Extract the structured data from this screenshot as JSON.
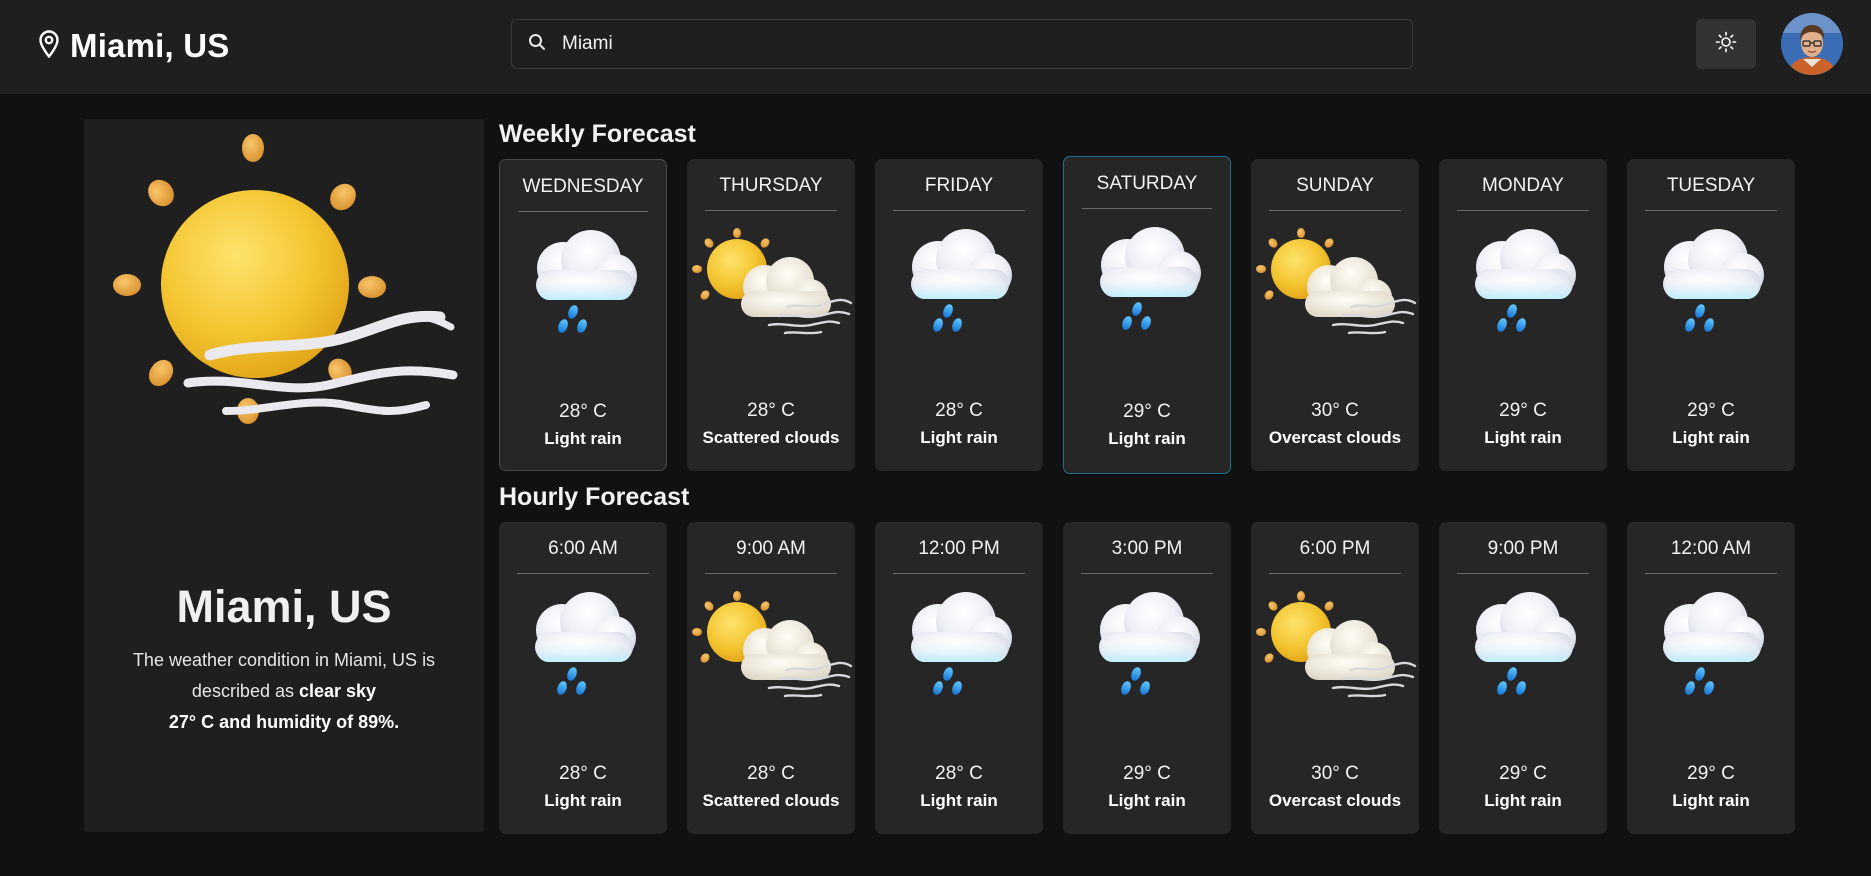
{
  "header": {
    "location": "Miami, US",
    "search_value": "Miami"
  },
  "current": {
    "city": "Miami, US",
    "desc_prefix": "The weather condition in Miami, US is described as",
    "desc_condition": "clear sky",
    "desc_detail": "27° C and humidity of 89%.",
    "icon": "sun-with-wind-icon"
  },
  "weekly": {
    "title": "Weekly Forecast",
    "days": [
      {
        "label": "Wednesday",
        "temp": "28° C",
        "cond": "Light rain",
        "icon": "rain-cloud-icon"
      },
      {
        "label": "Thursday",
        "temp": "28° C",
        "cond": "Scattered clouds",
        "icon": "partly-cloudy-wind-icon"
      },
      {
        "label": "Friday",
        "temp": "28° C",
        "cond": "Light rain",
        "icon": "rain-cloud-icon"
      },
      {
        "label": "Saturday",
        "temp": "29° C",
        "cond": "Light rain",
        "icon": "rain-cloud-icon"
      },
      {
        "label": "Sunday",
        "temp": "30° C",
        "cond": "Overcast clouds",
        "icon": "partly-cloudy-wind-icon"
      },
      {
        "label": "Monday",
        "temp": "29° C",
        "cond": "Light rain",
        "icon": "rain-cloud-icon"
      },
      {
        "label": "Tuesday",
        "temp": "29° C",
        "cond": "Light rain",
        "icon": "rain-cloud-icon"
      }
    ]
  },
  "hourly": {
    "title": "Hourly Forecast",
    "hours": [
      {
        "label": "6:00 AM",
        "temp": "28° C",
        "cond": "Light rain",
        "icon": "rain-cloud-icon"
      },
      {
        "label": "9:00 AM",
        "temp": "28° C",
        "cond": "Scattered clouds",
        "icon": "partly-cloudy-wind-icon"
      },
      {
        "label": "12:00 PM",
        "temp": "28° C",
        "cond": "Light rain",
        "icon": "rain-cloud-icon"
      },
      {
        "label": "3:00 PM",
        "temp": "29° C",
        "cond": "Light rain",
        "icon": "rain-cloud-icon"
      },
      {
        "label": "6:00 PM",
        "temp": "30° C",
        "cond": "Overcast clouds",
        "icon": "partly-cloudy-wind-icon"
      },
      {
        "label": "9:00 PM",
        "temp": "29° C",
        "cond": "Light rain",
        "icon": "rain-cloud-icon"
      },
      {
        "label": "12:00 AM",
        "temp": "29° C",
        "cond": "Light rain",
        "icon": "rain-cloud-icon"
      }
    ]
  },
  "colors": {
    "background": "#111111",
    "panel": "#1f1f1f",
    "card": "#262626",
    "selected_border": "#1f6f93",
    "sun": "#f2c230",
    "rain_drop": "#2f9be6"
  }
}
